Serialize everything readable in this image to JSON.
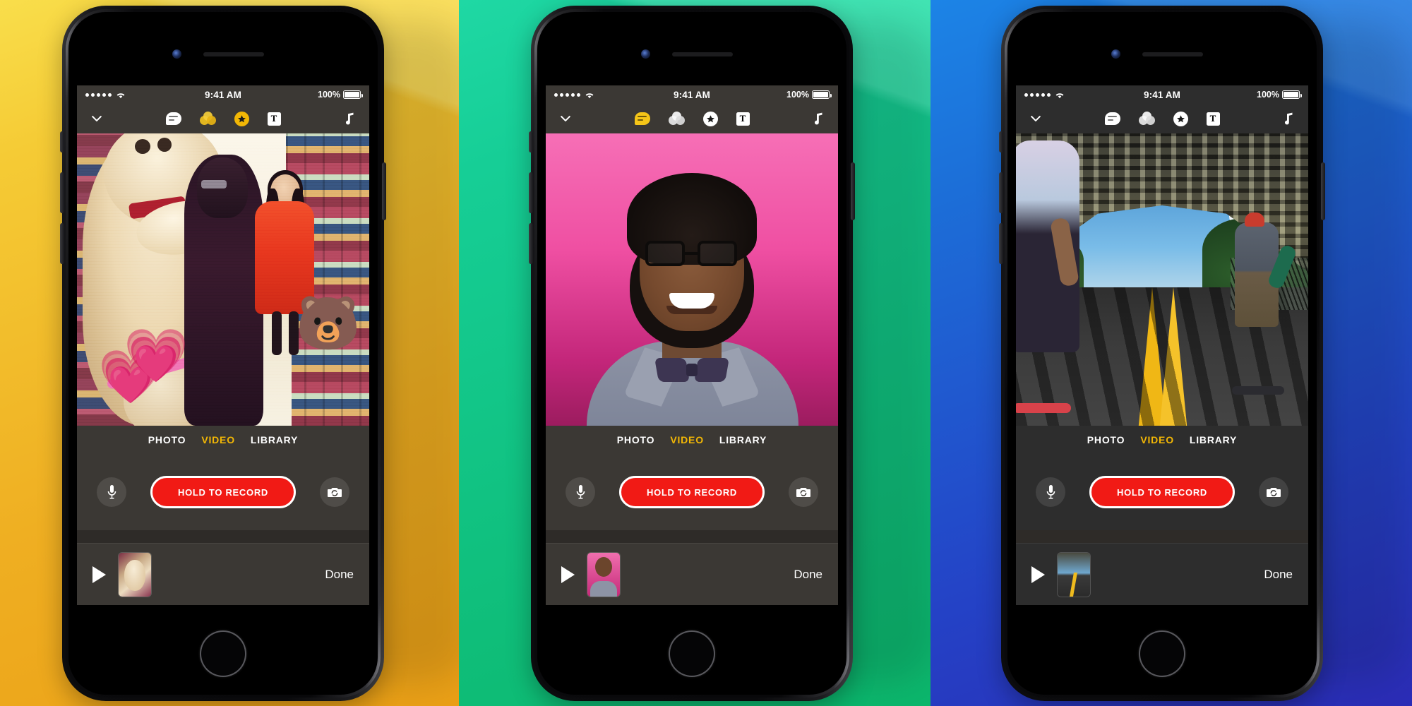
{
  "panels": [
    {
      "background_color": "#F5C52A",
      "status_bar": {
        "signal_dots": 5,
        "wifi": "wifi-icon",
        "time": "9:41 AM",
        "battery_percent": "100%"
      },
      "toolbar": {
        "collapse": "chevron-down-icon",
        "items": [
          {
            "name": "comic-filter",
            "icon": "speech-bubble-icon",
            "active": false
          },
          {
            "name": "filters",
            "icon": "filters-icon",
            "active": true
          },
          {
            "name": "stickers",
            "icon": "star-icon",
            "active": true
          },
          {
            "name": "text",
            "icon": "text-T-icon",
            "active": false
          }
        ],
        "music": "music-note-icon"
      },
      "preview": {
        "scene": "comic-filtered store scene with giant teddy bear",
        "emojis": [
          "bear-face",
          "two-hearts",
          "two-hearts"
        ]
      },
      "modes": {
        "options": [
          "PHOTO",
          "VIDEO",
          "LIBRARY"
        ],
        "selected": "VIDEO"
      },
      "controls": {
        "mic": "microphone-icon",
        "record_label": "HOLD TO RECORD",
        "flip": "camera-flip-icon"
      },
      "bottom": {
        "play": "play-icon",
        "thumbnail": "clip-thumbnail-teddy-bear",
        "done_label": "Done"
      }
    },
    {
      "background_color": "#12C68A",
      "status_bar": {
        "signal_dots": 5,
        "wifi": "wifi-icon",
        "time": "9:41 AM",
        "battery_percent": "100%"
      },
      "toolbar": {
        "collapse": "chevron-down-icon",
        "items": [
          {
            "name": "comic-filter",
            "icon": "speech-bubble-icon",
            "active": true
          },
          {
            "name": "filters",
            "icon": "filters-icon",
            "active": false
          },
          {
            "name": "stickers",
            "icon": "star-icon",
            "active": false
          },
          {
            "name": "text",
            "icon": "text-T-icon",
            "active": false
          }
        ],
        "music": "music-note-icon"
      },
      "preview": {
        "scene": "portrait of smiling man with glasses and bow tie on pink background",
        "emojis": []
      },
      "modes": {
        "options": [
          "PHOTO",
          "VIDEO",
          "LIBRARY"
        ],
        "selected": "VIDEO"
      },
      "controls": {
        "mic": "microphone-icon",
        "record_label": "HOLD TO RECORD",
        "flip": "camera-flip-icon"
      },
      "bottom": {
        "play": "play-icon",
        "thumbnail": "clip-thumbnail-portrait",
        "done_label": "Done"
      }
    },
    {
      "background_color": "#1F60D2",
      "status_bar": {
        "signal_dots": 5,
        "wifi": "wifi-icon",
        "time": "9:41 AM",
        "battery_percent": "100%"
      },
      "toolbar": {
        "collapse": "chevron-down-icon",
        "items": [
          {
            "name": "comic-filter",
            "icon": "speech-bubble-icon",
            "active": false
          },
          {
            "name": "filters",
            "icon": "filters-icon",
            "active": false
          },
          {
            "name": "stickers",
            "icon": "star-icon",
            "active": false
          },
          {
            "name": "text",
            "icon": "text-T-icon",
            "active": false
          }
        ],
        "music": "music-note-icon"
      },
      "preview": {
        "scene": "skateboarders riding under a steel bridge with yellow road lines",
        "emojis": []
      },
      "modes": {
        "options": [
          "PHOTO",
          "VIDEO",
          "LIBRARY"
        ],
        "selected": "VIDEO"
      },
      "controls": {
        "mic": "microphone-icon",
        "record_label": "HOLD TO RECORD",
        "flip": "camera-flip-icon"
      },
      "bottom": {
        "play": "play-icon",
        "thumbnail": "clip-thumbnail-bridge",
        "done_label": "Done"
      }
    }
  ],
  "colors": {
    "accent_yellow": "#F2B705",
    "record_red": "#F11A15",
    "chrome_warm": "#3B3834",
    "chrome_dark": "#2D2D2D"
  }
}
